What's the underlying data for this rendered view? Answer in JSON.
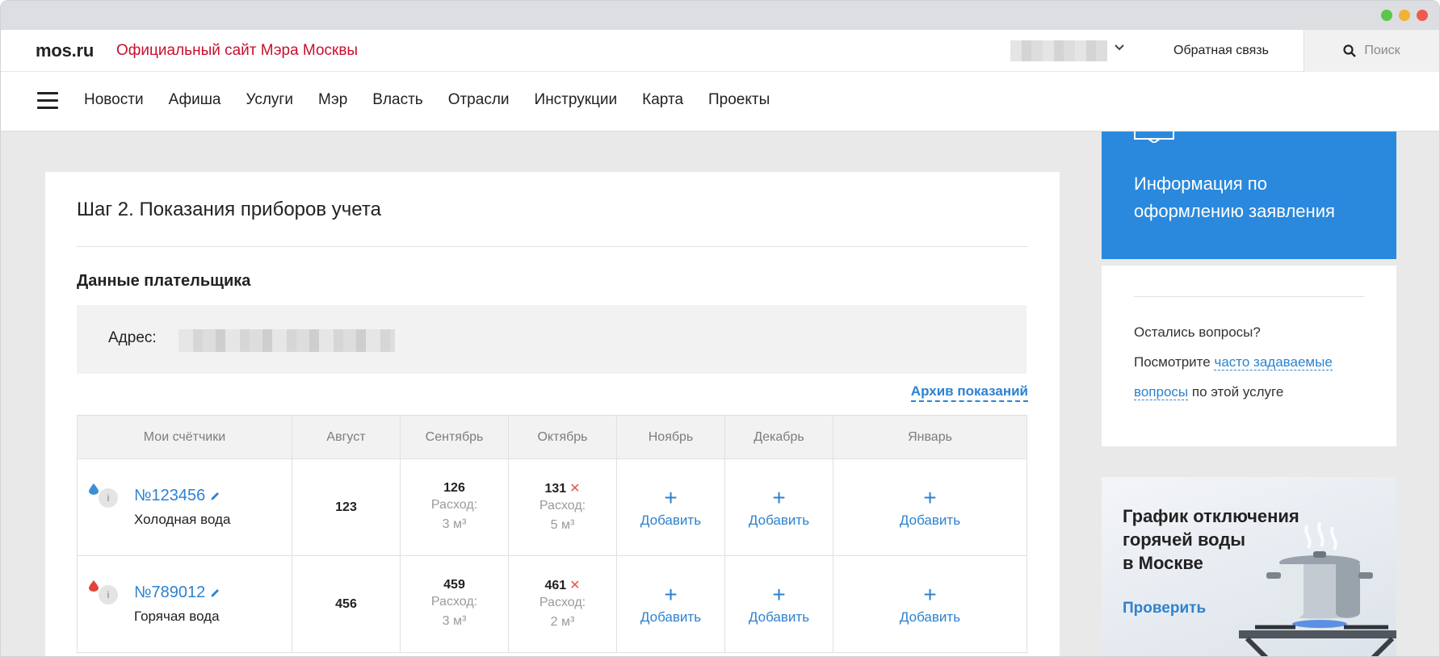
{
  "header": {
    "logo": "mos.ru",
    "subtitle": "Официальный сайт Мэра Москвы",
    "feedback": "Обратная связь",
    "search": "Поиск"
  },
  "nav": {
    "items": [
      "Новости",
      "Афиша",
      "Услуги",
      "Мэр",
      "Власть",
      "Отрасли",
      "Инструкции",
      "Карта",
      "Проекты"
    ]
  },
  "form": {
    "step_title": "Шаг 2. Показания приборов учета",
    "payer_title": "Данные плательщика",
    "address_label": "Адрес:",
    "archive_link": "Архив показаний"
  },
  "table": {
    "headers": [
      "Мои счётчики",
      "Август",
      "Сентябрь",
      "Октябрь",
      "Ноябрь",
      "Декабрь",
      "Январь"
    ],
    "usage_label": "Расход:",
    "add_label": "Добавить",
    "rows": [
      {
        "meter_number": "№123456",
        "meter_type": "Холодная вода",
        "drop_color": "#3b8fd6",
        "aug": "123",
        "sep": {
          "value": "126",
          "usage": "3 м³"
        },
        "oct": {
          "value": "131",
          "usage": "5 м³",
          "error": "✕"
        }
      },
      {
        "meter_number": "№789012",
        "meter_type": "Горячая вода",
        "drop_color": "#e0443a",
        "aug": "456",
        "sep": {
          "value": "459",
          "usage": "3 м³"
        },
        "oct": {
          "value": "461",
          "usage": "2 м³",
          "error": "✕"
        }
      }
    ]
  },
  "sidebar": {
    "info_title_line1": "Информация по",
    "info_title_line2": "оформлению заявления",
    "faq_question": "Остались вопросы?",
    "faq_prefix": "Посмотрите",
    "faq_link": "часто задаваемые вопросы",
    "faq_suffix": "по этой услуге",
    "hotwater_line1": "График отключения",
    "hotwater_line2": "горячей воды",
    "hotwater_line3": "в Москве",
    "hotwater_link": "Проверить"
  },
  "colors": {
    "brand_red": "#c8102e",
    "link_blue": "#2d82d0",
    "info_blue": "#2a89dc",
    "error_red": "#e05a4e"
  },
  "icons": [
    "hamburger-icon",
    "search-icon",
    "chevron-down-icon",
    "water-drop-icon",
    "info-icon",
    "pencil-icon",
    "close-icon",
    "plus-icon"
  ]
}
